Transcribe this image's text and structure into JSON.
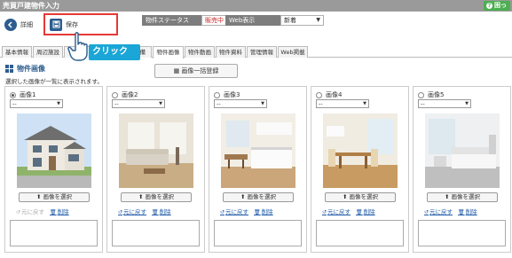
{
  "window": {
    "title": "売買戸建物件入力",
    "help_label": "困っ"
  },
  "toolbar": {
    "detail_label": "詳細",
    "save_label": "保存",
    "status_label": "物件ステータス",
    "status_value": "販売中",
    "web_label": "Web表示",
    "web_value": "新着"
  },
  "annotation": {
    "click_text": "クリック"
  },
  "tabs": [
    {
      "label": "基本情報"
    },
    {
      "label": "周辺施設"
    },
    {
      "label": ""
    },
    {
      "label": "備"
    },
    {
      "label": "物件画像"
    },
    {
      "label": "物件動画"
    },
    {
      "label": "物件資料"
    },
    {
      "label": "管理情報"
    },
    {
      "label": "Web掲載"
    }
  ],
  "section": {
    "title": "物件画像",
    "bulk_register_label": "画像一括登録",
    "description": "選択した画像が一覧に表示されます。"
  },
  "cards": [
    {
      "title": "画像1",
      "select_value": "--",
      "choose_label": "画像を選択",
      "restore_label": "元に戻す",
      "delete_label": "削除",
      "selected": true,
      "restore_disabled": true,
      "photo": "house-exterior"
    },
    {
      "title": "画像2",
      "select_value": "--",
      "choose_label": "画像を選択",
      "restore_label": "元に戻す",
      "delete_label": "削除",
      "selected": false,
      "restore_disabled": false,
      "photo": "living-room"
    },
    {
      "title": "画像3",
      "select_value": "--",
      "choose_label": "画像を選択",
      "restore_label": "元に戻す",
      "delete_label": "削除",
      "selected": false,
      "restore_disabled": false,
      "photo": "kitchen"
    },
    {
      "title": "画像4",
      "select_value": "--",
      "choose_label": "画像を選択",
      "restore_label": "元に戻す",
      "delete_label": "削除",
      "selected": false,
      "restore_disabled": false,
      "photo": "dining-room"
    },
    {
      "title": "画像5",
      "select_value": "--",
      "choose_label": "画像を選択",
      "restore_label": "元に戻す",
      "delete_label": "削除",
      "selected": false,
      "restore_disabled": false,
      "photo": "bedroom"
    }
  ],
  "colors": {
    "titlebar": "#9a9a9a",
    "accent": "#2d5d8f",
    "highlight": "#e53935",
    "callout": "#1aa6d6",
    "help": "#4caf50"
  }
}
